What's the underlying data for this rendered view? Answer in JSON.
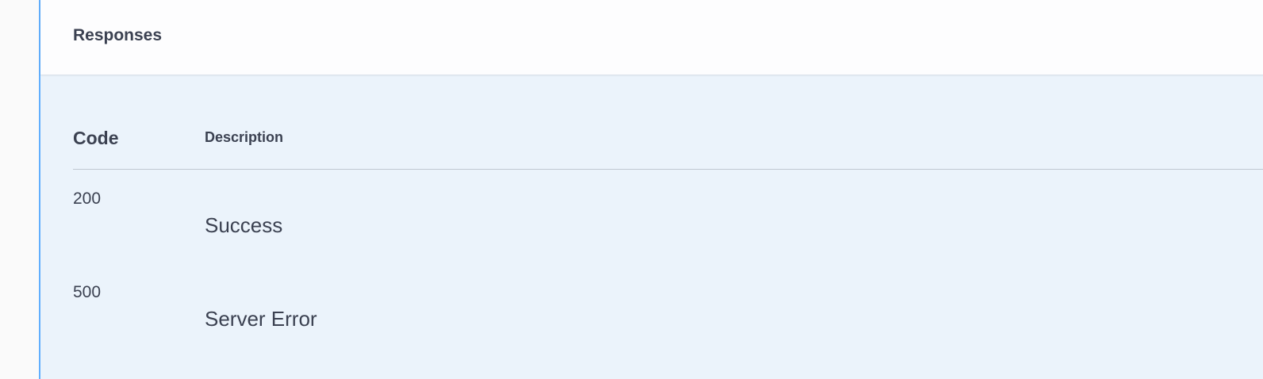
{
  "title": "Responses",
  "columns": {
    "code": "Code",
    "description": "Description"
  },
  "responses": [
    {
      "code": "200",
      "description": "Success"
    },
    {
      "code": "500",
      "description": "Server Error"
    }
  ],
  "colors": {
    "accent": "#61affe",
    "panel": "#ebf3fb",
    "text": "#3b4151"
  }
}
